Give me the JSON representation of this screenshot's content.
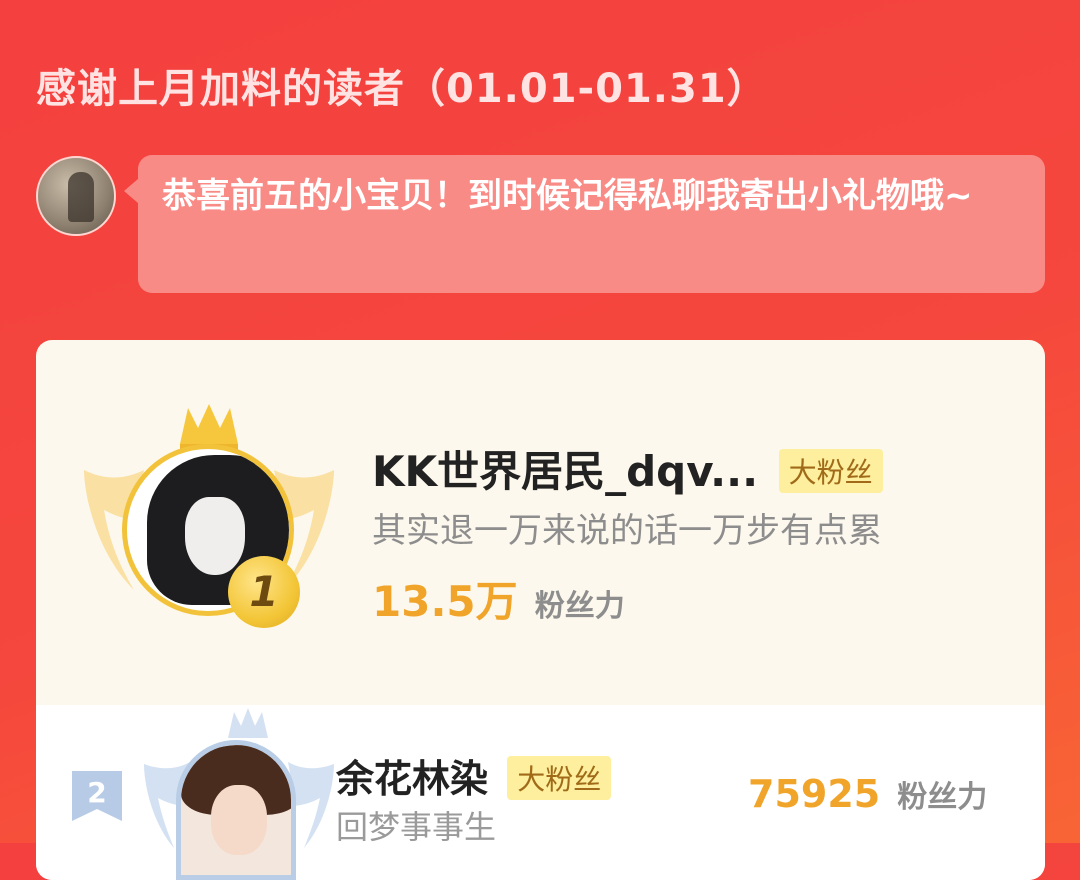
{
  "header": {
    "title": "感谢上月加料的读者（01.01-01.31）"
  },
  "message": {
    "text": "恭喜前五的小宝贝！到时候记得私聊我寄出小礼物哦~"
  },
  "ranking": [
    {
      "rank": "1",
      "name": "KK世界居民_dqv...",
      "badge": "大粉丝",
      "description": "其实退一万来说的话一万步有点累",
      "power_value": "13.5万",
      "power_unit": "粉丝力"
    },
    {
      "rank": "2",
      "name": "余花林染",
      "badge": "大粉丝",
      "description": "回梦事事生",
      "power_value": "75925",
      "power_unit": "粉丝力"
    }
  ],
  "colors": {
    "background": "#f4403f",
    "accent_gold": "#f0a42a",
    "badge_bg": "#fdef9d"
  },
  "icons": {
    "rank1_crown": "crown-icon",
    "rank1_wings": "wings-icon",
    "rank2_wings": "wings-icon"
  }
}
